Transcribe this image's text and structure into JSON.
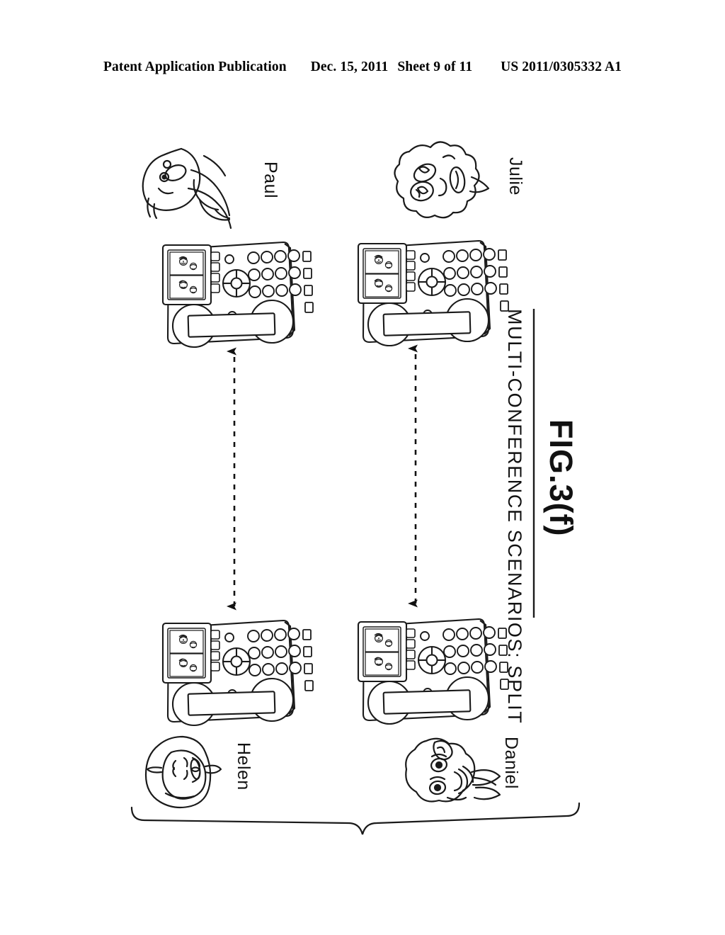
{
  "header": {
    "publication": "Patent Application Publication",
    "date": "Dec. 15, 2011",
    "sheet": "Sheet 9 of 11",
    "doc_number": "US 2011/0305332 A1"
  },
  "figure": {
    "caption_title": "MULTI-CONFERENCE SCENARIOS:  SPLIT",
    "figure_number": "FIG.3(f)",
    "orientation": "landscape-rotated-90",
    "ink_color": "#000000",
    "background_color": "#ffffff"
  },
  "participants": [
    {
      "id": "paul",
      "label": "Paul",
      "position": "top-left",
      "avatar": "person-with-shirt-collar-face-icon"
    },
    {
      "id": "julie",
      "label": "Julie",
      "position": "top-right",
      "avatar": "curly-hair-face-icon"
    },
    {
      "id": "helen",
      "label": "Helen",
      "position": "bottom-left",
      "avatar": "straight-hair-face-icon"
    },
    {
      "id": "daniel",
      "label": "Daniel",
      "position": "bottom-right",
      "avatar": "short-hair-face-icon"
    }
  ],
  "devices": [
    {
      "id": "phone-paul",
      "owner": "Paul",
      "type": "desk-conference-telephone"
    },
    {
      "id": "phone-julie",
      "owner": "Julie",
      "type": "desk-conference-telephone"
    },
    {
      "id": "phone-helen",
      "owner": "Helen",
      "type": "desk-conference-telephone"
    },
    {
      "id": "phone-daniel",
      "owner": "Daniel",
      "type": "desk-conference-telephone"
    }
  ],
  "phone_detail": {
    "display_thumbnails": 4,
    "keypad_rows": 3,
    "keypad_columns": 4,
    "side_buttons": 4,
    "has_navigation_wheel": true,
    "has_handset": true
  },
  "connections": [
    {
      "id": "link-paul-helen",
      "from": "phone-helen",
      "to": "phone-paul",
      "style": "dashed",
      "arrowheads": "both"
    },
    {
      "id": "link-julie-daniel",
      "from": "phone-daniel",
      "to": "phone-julie",
      "style": "dashed",
      "arrowheads": "both"
    }
  ],
  "grouping_brace": {
    "id": "split-group-brace",
    "orientation": "downward-pointing",
    "spans": [
      "Helen",
      "Daniel"
    ]
  }
}
